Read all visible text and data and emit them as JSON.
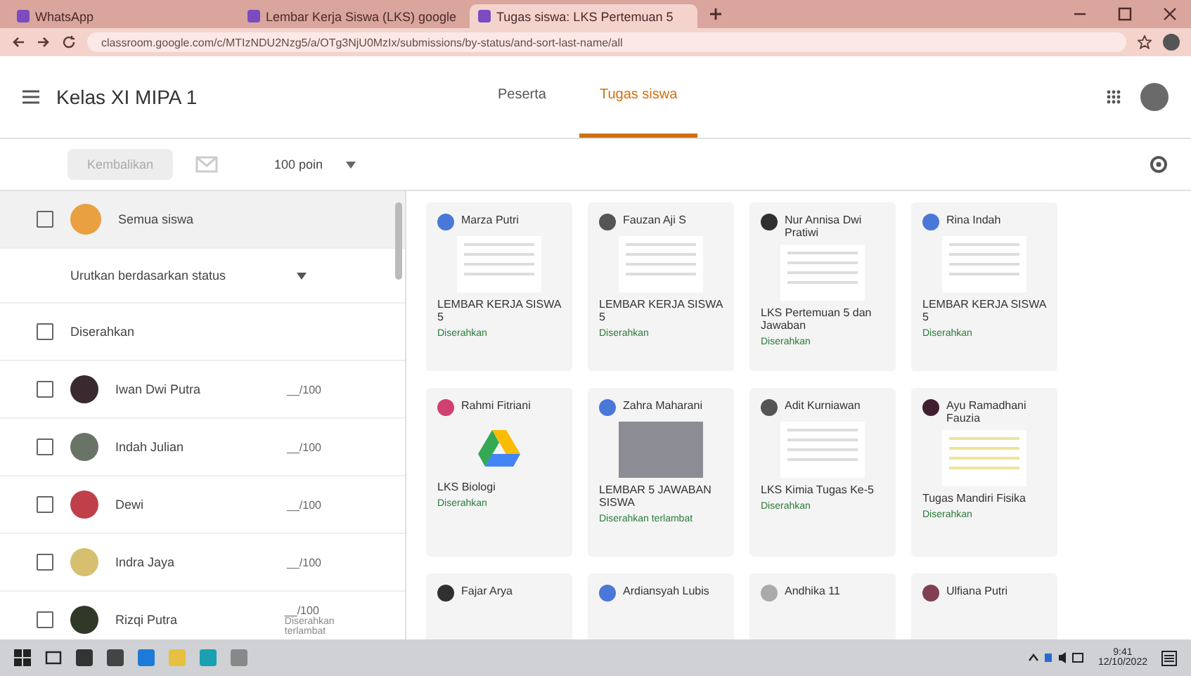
{
  "browser": {
    "tabs": [
      {
        "title": "WhatsApp",
        "selected": false
      },
      {
        "title": "Lembar Kerja Siswa (LKS) google",
        "selected": false
      },
      {
        "title": "Tugas siswa: LKS Pertemuan 5",
        "selected": true
      }
    ],
    "url": "classroom.google.com/c/MTIzNDU2Nzg5/a/OTg3NjU0MzIx/submissions/by-status/and-sort-last-name/all"
  },
  "header": {
    "class_name": "Kelas XI MIPA 1",
    "tabs": [
      {
        "label": "Peserta",
        "selected": false
      },
      {
        "label": "Tugas siswa",
        "selected": true
      }
    ]
  },
  "toolbar": {
    "return_button": "Kembalikan",
    "return_disabled": true,
    "points": "100 poin"
  },
  "sidebar": {
    "all_students": "Semua siswa",
    "all_checked": false,
    "sort": "Urutkan berdasarkan status",
    "section": "Diserahkan",
    "section_checked": false,
    "students": [
      {
        "name": "Iwan Dwi Putra",
        "grade": "__/100",
        "color": "#3a2a30",
        "checked": false
      },
      {
        "name": "Indah Julian",
        "grade": "__/100",
        "color": "#6a7466",
        "checked": false
      },
      {
        "name": "Dewi",
        "grade": "__/100",
        "color": "#c0404a",
        "checked": false
      },
      {
        "name": "Indra Jaya",
        "grade": "__/100",
        "color": "#d6c070",
        "checked": false
      },
      {
        "name": "Rizqi Putra",
        "grade": "__/100",
        "note": "Diserahkan terlambat",
        "color": "#303828",
        "checked": false
      }
    ]
  },
  "submissions": [
    {
      "name": "Marza Putri",
      "color": "#4a78d8",
      "kind": "doc",
      "title": "LEMBAR KERJA SISWA 5",
      "status": "Diserahkan"
    },
    {
      "name": "Fauzan Aji S",
      "color": "#555555",
      "kind": "doc",
      "title": "LEMBAR KERJA SISWA 5",
      "status": "Diserahkan"
    },
    {
      "name": "Nur Annisa Dwi Pratiwi",
      "color": "#303030",
      "kind": "doc",
      "title": "LKS Pertemuan 5 dan Jawaban",
      "status": "Diserahkan"
    },
    {
      "name": "Rina Indah",
      "color": "#4a78d8",
      "kind": "doc",
      "title": "LEMBAR KERJA SISWA 5",
      "status": "Diserahkan"
    },
    {
      "name": "Rahmi Fitriani",
      "color": "#d04070",
      "kind": "drive",
      "title": "LKS Biologi",
      "status": "Diserahkan"
    },
    {
      "name": "Zahra Maharani",
      "color": "#4a78d8",
      "kind": "photo",
      "title": "LEMBAR 5 JAWABAN SISWA",
      "status": "Diserahkan terlambat"
    },
    {
      "name": "Adit Kurniawan",
      "color": "#555555",
      "kind": "doc",
      "title": "LKS Kimia Tugas Ke-5",
      "status": "Diserahkan"
    },
    {
      "name": "Ayu Ramadhani Fauzia",
      "color": "#402030",
      "kind": "sheet",
      "title": "Tugas Mandiri Fisika",
      "status": "Diserahkan"
    },
    {
      "name": "Fajar Arya",
      "color": "#303030",
      "kind": "none"
    },
    {
      "name": "Ardiansyah Lubis",
      "color": "#4a78d8",
      "kind": "none"
    },
    {
      "name": "Andhika 11",
      "color": "#aaaaaa",
      "kind": "none"
    },
    {
      "name": "Ulfiana Putri",
      "color": "#804050",
      "kind": "none"
    }
  ],
  "taskbar": {
    "time": "9:41",
    "date": "12/10/2022"
  }
}
